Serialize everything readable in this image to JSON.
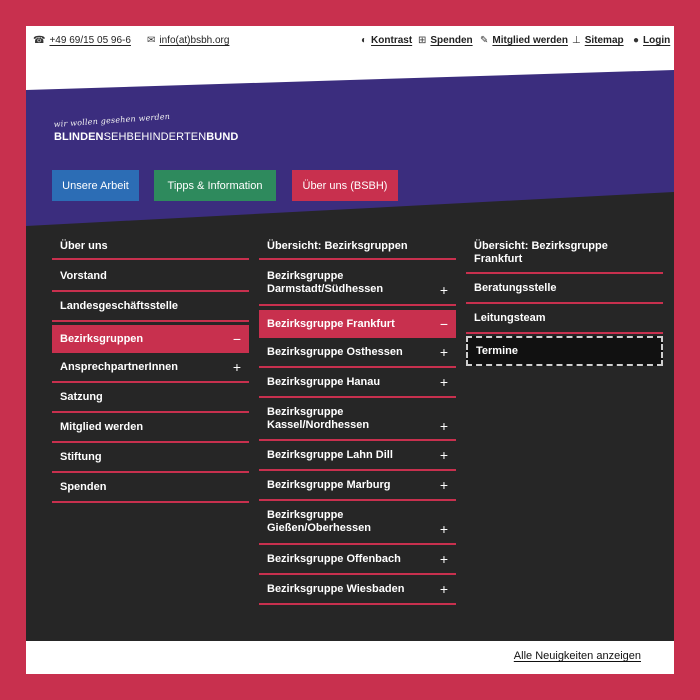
{
  "topbar": {
    "phone": {
      "icon": "phone-icon",
      "text": "+49 69/15 05 96-6"
    },
    "email": {
      "icon": "mail-icon",
      "text": "info(at)bsbh.org"
    },
    "links": [
      {
        "icon": "contrast-icon",
        "label": "Kontrast"
      },
      {
        "icon": "gift-icon",
        "label": "Spenden"
      },
      {
        "icon": "pen-icon",
        "label": "Mitglied werden"
      },
      {
        "icon": "sitemap-icon",
        "label": "Sitemap"
      },
      {
        "icon": "user-icon",
        "label": "Login"
      }
    ]
  },
  "logo": {
    "tagline": "wir wollen gesehen werden",
    "name_bold_1": "BLINDEN",
    "name_thin": "SEHBEHINDERTEN",
    "name_bold_2": "BUND"
  },
  "tabs": [
    {
      "label": "Unsere Arbeit",
      "color": "#2c6db5"
    },
    {
      "label": "Tipps & Information",
      "color": "#2e8a5d"
    },
    {
      "label": "Über uns (BSBH)",
      "color": "#c8304e"
    }
  ],
  "menu": {
    "col1": [
      {
        "label": "Über uns",
        "toggle": ""
      },
      {
        "label": "Vorstand",
        "toggle": ""
      },
      {
        "label": "Landesgeschäftsstelle",
        "toggle": ""
      },
      {
        "label": "Bezirksgruppen",
        "toggle": "−",
        "state": "active"
      },
      {
        "label": "AnsprechpartnerInnen",
        "toggle": "+"
      },
      {
        "label": "Satzung",
        "toggle": ""
      },
      {
        "label": "Mitglied werden",
        "toggle": ""
      },
      {
        "label": "Stiftung",
        "toggle": ""
      },
      {
        "label": "Spenden",
        "toggle": ""
      }
    ],
    "col2": [
      {
        "label": "Übersicht: Bezirksgruppen",
        "toggle": ""
      },
      {
        "label": "Bezirksgruppe Darmstadt/Südhessen",
        "toggle": "+"
      },
      {
        "label": "Bezirksgruppe Frankfurt",
        "toggle": "−",
        "state": "active"
      },
      {
        "label": "Bezirksgruppe Osthessen",
        "toggle": "+"
      },
      {
        "label": "Bezirksgruppe Hanau",
        "toggle": "+"
      },
      {
        "label": "Bezirksgruppe Kassel/Nordhessen",
        "toggle": "+"
      },
      {
        "label": "Bezirksgruppe Lahn Dill",
        "toggle": "+"
      },
      {
        "label": "Bezirksgruppe Marburg",
        "toggle": "+"
      },
      {
        "label": "Bezirksgruppe Gießen/Oberhessen",
        "toggle": "+"
      },
      {
        "label": "Bezirksgruppe Offenbach",
        "toggle": "+"
      },
      {
        "label": "Bezirksgruppe Wiesbaden",
        "toggle": "+"
      }
    ],
    "col3": [
      {
        "label": "Übersicht: Bezirksgruppe Frankfurt",
        "toggle": ""
      },
      {
        "label": "Beratungsstelle",
        "toggle": ""
      },
      {
        "label": "Leitungsteam",
        "toggle": ""
      },
      {
        "label": "Termine",
        "toggle": "",
        "state": "focus"
      }
    ]
  },
  "footer_link": "Alle Neuigkeiten anzeigen",
  "colors": {
    "accent": "#c8304e",
    "band": "#3b2d7e",
    "dark": "#262626"
  }
}
